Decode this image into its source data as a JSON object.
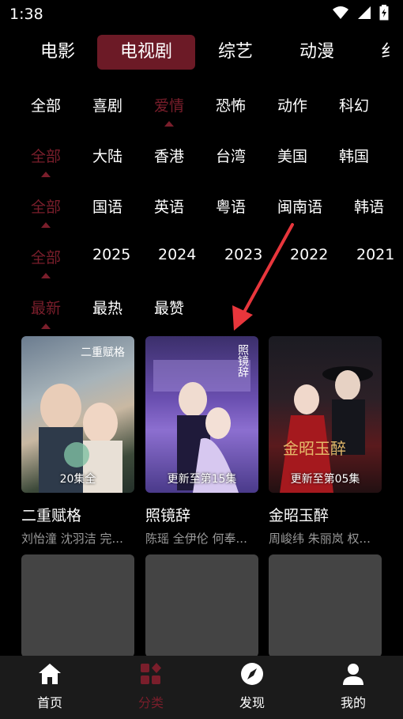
{
  "status": {
    "time": "1:38"
  },
  "categories": [
    {
      "label": "电影"
    },
    {
      "label": "电视剧"
    },
    {
      "label": "综艺"
    },
    {
      "label": "动漫"
    },
    {
      "label": "纟"
    }
  ],
  "filters": {
    "genre": [
      "全部",
      "喜剧",
      "爱情",
      "恐怖",
      "动作",
      "科幻"
    ],
    "region": [
      "全部",
      "大陆",
      "香港",
      "台湾",
      "美国",
      "韩国"
    ],
    "language": [
      "全部",
      "国语",
      "英语",
      "粤语",
      "闽南语",
      "韩语"
    ],
    "year": [
      "全部",
      "2025",
      "2024",
      "2023",
      "2022",
      "2021"
    ],
    "sort": [
      "最新",
      "最热",
      "最赞"
    ]
  },
  "shows": [
    {
      "title": "二重赋格",
      "actors": "刘怡潼  沈羽洁  完...",
      "badge": "20集全",
      "poster_text": "二重赋格"
    },
    {
      "title": "照镜辞",
      "actors": "陈瑶  全伊伦  何奉...",
      "badge": "更新至第15集",
      "poster_text": "照镜辞"
    },
    {
      "title": "金昭玉醉",
      "actors": "周峻纬  朱丽岚  权...",
      "badge": "更新至第05集",
      "poster_text": "金昭玉醉"
    }
  ],
  "tabs": [
    {
      "label": "首页"
    },
    {
      "label": "分类"
    },
    {
      "label": "发现"
    },
    {
      "label": "我的"
    }
  ],
  "colors": {
    "accent": "#7a1e2b",
    "active_bg": "#6c1a26"
  }
}
